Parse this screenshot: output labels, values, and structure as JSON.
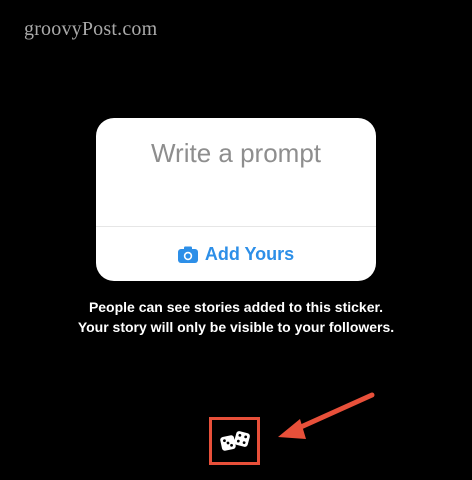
{
  "watermark": "groovyPost.com",
  "sticker": {
    "prompt_placeholder": "Write a prompt",
    "add_yours_label": "Add Yours"
  },
  "info_text": "People can see stories added to this sticker. Your story will only be visible to your followers.",
  "icons": {
    "camera": "camera-icon",
    "dice": "dice-icon",
    "arrow": "arrow-icon"
  },
  "colors": {
    "background": "#000000",
    "card": "#ffffff",
    "placeholder": "#8e8e8e",
    "accent": "#2d8fe8",
    "highlight": "#e8503a"
  }
}
